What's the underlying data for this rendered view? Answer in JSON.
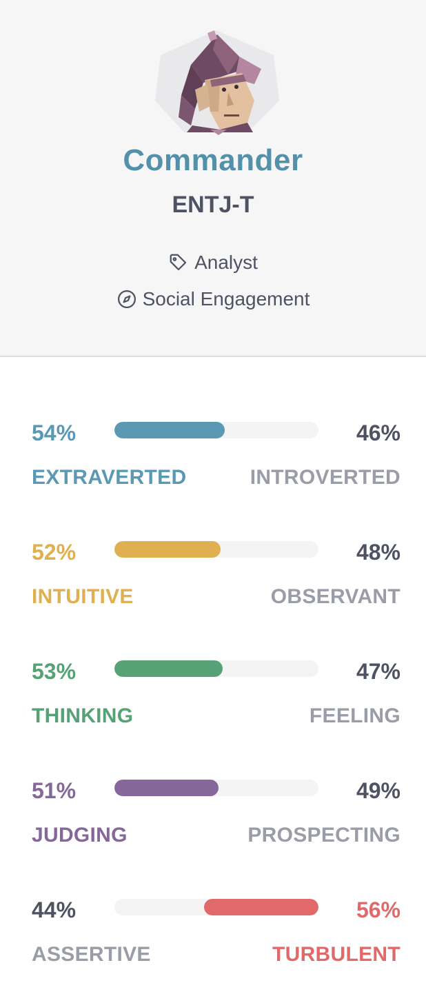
{
  "profile": {
    "name": "Commander",
    "code": "ENTJ-T",
    "role": "Analyst",
    "strategy": "Social Engagement",
    "name_color": "#5390aa"
  },
  "icons": {
    "role": "tag-icon",
    "strategy": "compass-icon",
    "avatar": "commander-avatar"
  },
  "traits": [
    {
      "left_pct": "54%",
      "right_pct": "46%",
      "left_label": "EXTRAVERTED",
      "right_label": "INTROVERTED",
      "dominant": "left",
      "fill_fraction": 0.54,
      "color": "#5a98b3"
    },
    {
      "left_pct": "52%",
      "right_pct": "48%",
      "left_label": "INTUITIVE",
      "right_label": "OBSERVANT",
      "dominant": "left",
      "fill_fraction": 0.52,
      "color": "#e0af4f"
    },
    {
      "left_pct": "53%",
      "right_pct": "47%",
      "left_label": "THINKING",
      "right_label": "FEELING",
      "dominant": "left",
      "fill_fraction": 0.53,
      "color": "#56a276"
    },
    {
      "left_pct": "51%",
      "right_pct": "49%",
      "left_label": "JUDGING",
      "right_label": "PROSPECTING",
      "dominant": "left",
      "fill_fraction": 0.51,
      "color": "#85679a"
    },
    {
      "left_pct": "44%",
      "right_pct": "56%",
      "left_label": "ASSERTIVE",
      "right_label": "TURBULENT",
      "dominant": "right",
      "fill_fraction": 0.56,
      "color": "#e2696a"
    }
  ]
}
